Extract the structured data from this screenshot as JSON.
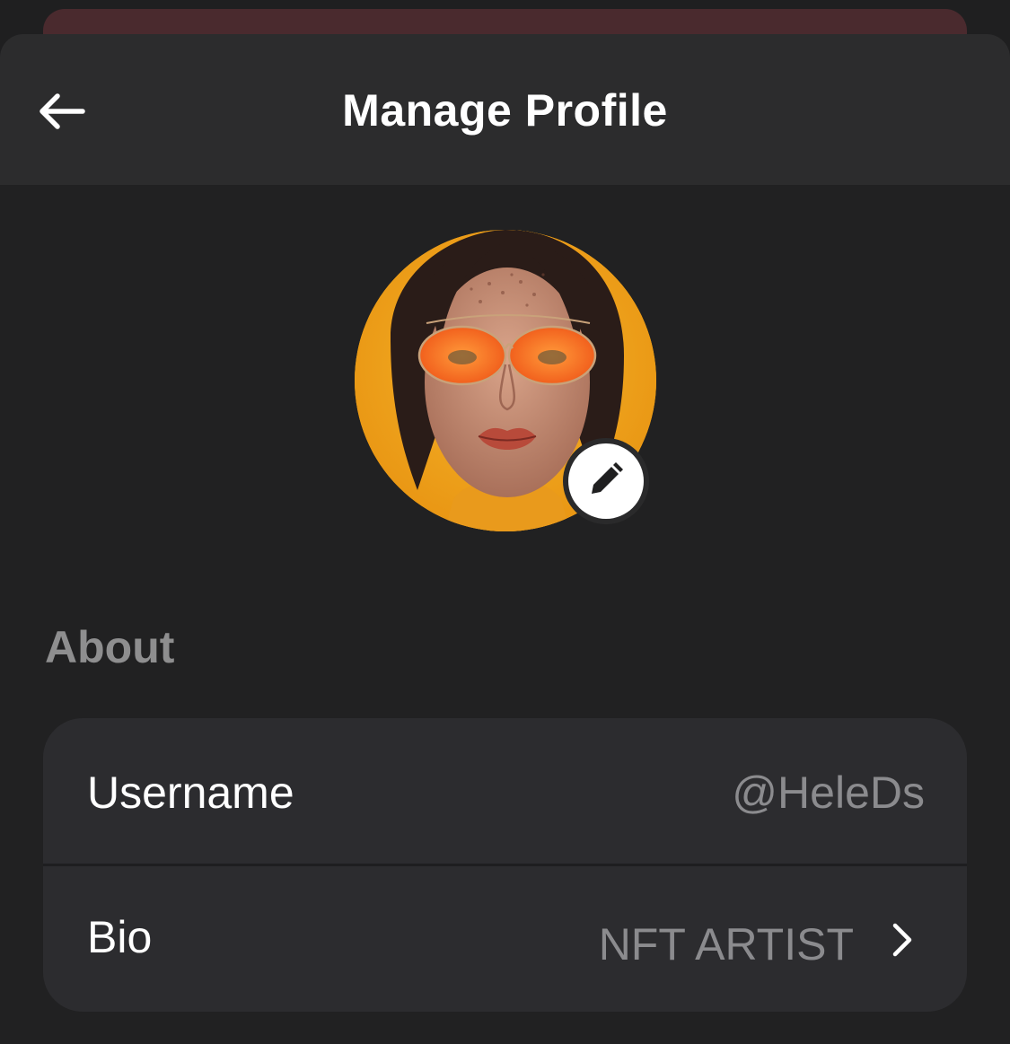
{
  "header": {
    "title": "Manage Profile",
    "back_icon": "arrow-left-icon"
  },
  "avatar": {
    "edit_icon": "pencil-icon",
    "background_color": "#f2a81a"
  },
  "about": {
    "section_label": "About",
    "rows": [
      {
        "label": "Username",
        "value": "@HeleDs"
      },
      {
        "label": "Bio",
        "value": "NFT ARTIST",
        "icon": "chevron-right-icon"
      }
    ]
  },
  "colors": {
    "background": "#1f1f20",
    "header": "#2c2c2d",
    "card": "#2c2c2f",
    "muted_text": "#8e8e8f"
  }
}
